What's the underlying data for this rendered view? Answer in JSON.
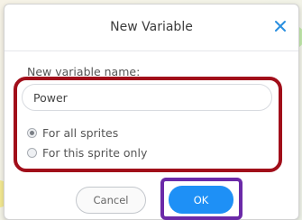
{
  "dialog": {
    "title": "New Variable",
    "close_icon": "close-icon"
  },
  "form": {
    "name_label": "New variable name:",
    "name_value": "Power",
    "scope_options": [
      {
        "label": "For all sprites",
        "selected": true
      },
      {
        "label": "For this sprite only",
        "selected": false
      }
    ]
  },
  "buttons": {
    "cancel_label": "Cancel",
    "ok_label": "OK"
  },
  "colors": {
    "accent": "#1e90f6",
    "highlight_red": "#a10e1a",
    "highlight_purple": "#6b2aa8",
    "close_icon": "#2a8fe0"
  }
}
